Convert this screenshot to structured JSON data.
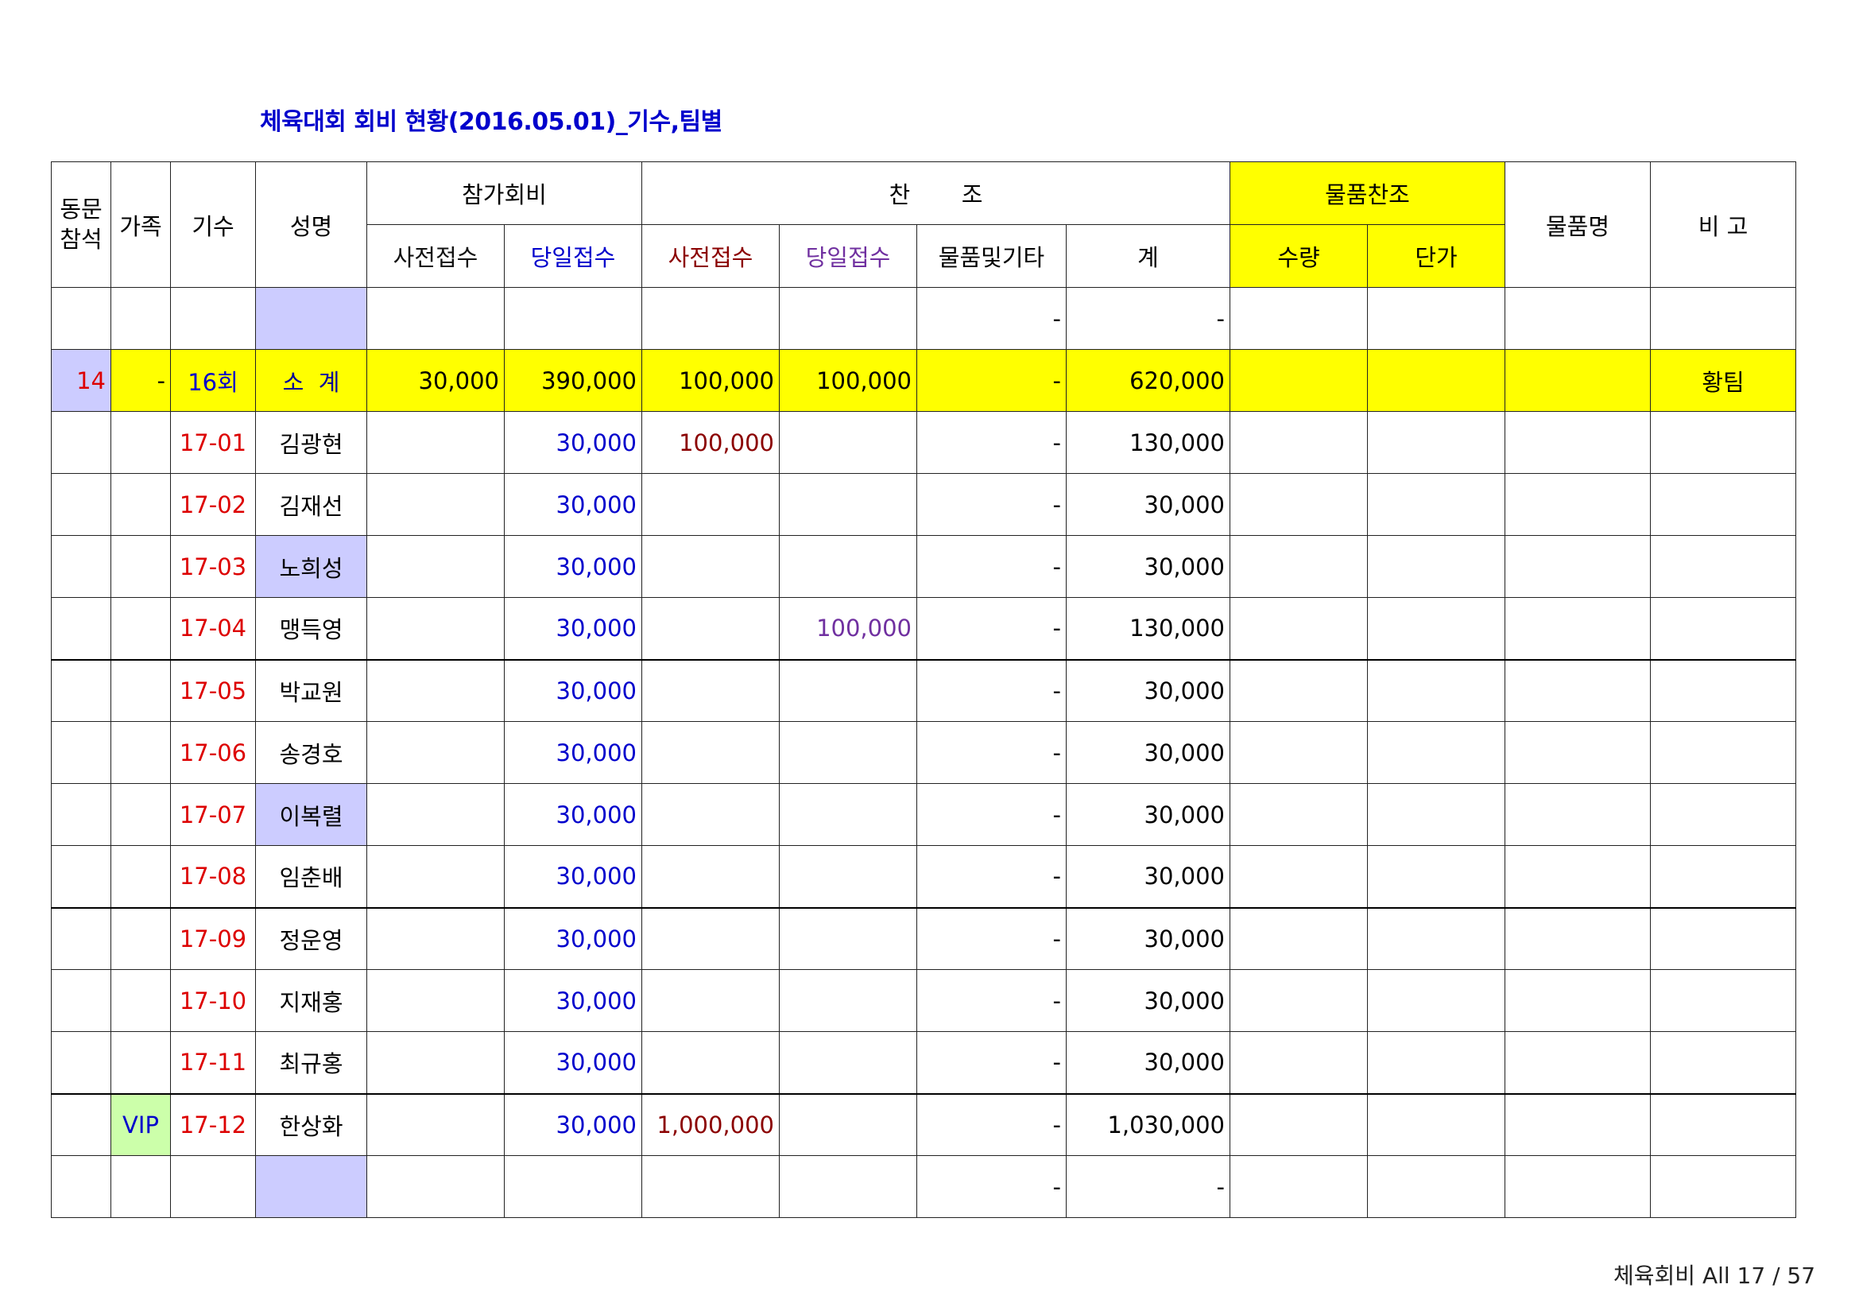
{
  "title": "체육대회 회비 현황(2016.05.01)_기수,팀별",
  "headers": {
    "dongmun": "동문\n참석",
    "family": "가족",
    "gisu": "기수",
    "name": "성명",
    "participation_fee": "참가회비",
    "sponsorship": "찬       조",
    "goods_sponsorship": "물품찬조",
    "goods_name": "물품명",
    "remarks": "비 고",
    "pre_receipt": "사전접수",
    "day_receipt": "당일접수",
    "spon_pre_receipt": "사전접수",
    "spon_day_receipt": "당일접수",
    "goods_etc": "물품및기타",
    "total": "계",
    "quantity": "수량",
    "unit_price": "단가"
  },
  "blank_top_row": {
    "goods_etc": "-",
    "total": "-"
  },
  "subtotal_row": {
    "dongmun": "14",
    "family": "-",
    "gisu": "16회",
    "name": "소  계",
    "pre_receipt": "30,000",
    "day_receipt": "390,000",
    "spon_pre": "100,000",
    "spon_day": "100,000",
    "goods_etc": "-",
    "total": "620,000",
    "remarks": "황팀"
  },
  "rows": [
    {
      "family": "",
      "gisu": "17-01",
      "name": "김광현",
      "day_receipt": "30,000",
      "spon_pre": "100,000",
      "spon_day": "",
      "goods_etc": "-",
      "total": "130,000"
    },
    {
      "family": "",
      "gisu": "17-02",
      "name": "김재선",
      "day_receipt": "30,000",
      "spon_pre": "",
      "spon_day": "",
      "goods_etc": "-",
      "total": "30,000"
    },
    {
      "family": "",
      "gisu": "17-03",
      "name": "노희성",
      "day_receipt": "30,000",
      "spon_pre": "",
      "spon_day": "",
      "goods_etc": "-",
      "total": "30,000"
    },
    {
      "family": "",
      "gisu": "17-04",
      "name": "맹득영",
      "day_receipt": "30,000",
      "spon_pre": "",
      "spon_day": "100,000",
      "goods_etc": "-",
      "total": "130,000"
    },
    {
      "family": "",
      "gisu": "17-05",
      "name": "박교원",
      "day_receipt": "30,000",
      "spon_pre": "",
      "spon_day": "",
      "goods_etc": "-",
      "total": "30,000"
    },
    {
      "family": "",
      "gisu": "17-06",
      "name": "송경호",
      "day_receipt": "30,000",
      "spon_pre": "",
      "spon_day": "",
      "goods_etc": "-",
      "total": "30,000"
    },
    {
      "family": "",
      "gisu": "17-07",
      "name": "이복렬",
      "day_receipt": "30,000",
      "spon_pre": "",
      "spon_day": "",
      "goods_etc": "-",
      "total": "30,000"
    },
    {
      "family": "",
      "gisu": "17-08",
      "name": "임춘배",
      "day_receipt": "30,000",
      "spon_pre": "",
      "spon_day": "",
      "goods_etc": "-",
      "total": "30,000"
    },
    {
      "family": "",
      "gisu": "17-09",
      "name": "정운영",
      "day_receipt": "30,000",
      "spon_pre": "",
      "spon_day": "",
      "goods_etc": "-",
      "total": "30,000"
    },
    {
      "family": "",
      "gisu": "17-10",
      "name": "지재홍",
      "day_receipt": "30,000",
      "spon_pre": "",
      "spon_day": "",
      "goods_etc": "-",
      "total": "30,000"
    },
    {
      "family": "",
      "gisu": "17-11",
      "name": "최규홍",
      "day_receipt": "30,000",
      "spon_pre": "",
      "spon_day": "",
      "goods_etc": "-",
      "total": "30,000"
    },
    {
      "family": "VIP",
      "gisu": "17-12",
      "name": "한상화",
      "day_receipt": "30,000",
      "spon_pre": "1,000,000",
      "spon_day": "",
      "goods_etc": "-",
      "total": "1,030,000"
    }
  ],
  "blank_bottom_row": {
    "goods_etc": "-",
    "total": "-"
  },
  "footer": "체육회비 All 17 / 57"
}
